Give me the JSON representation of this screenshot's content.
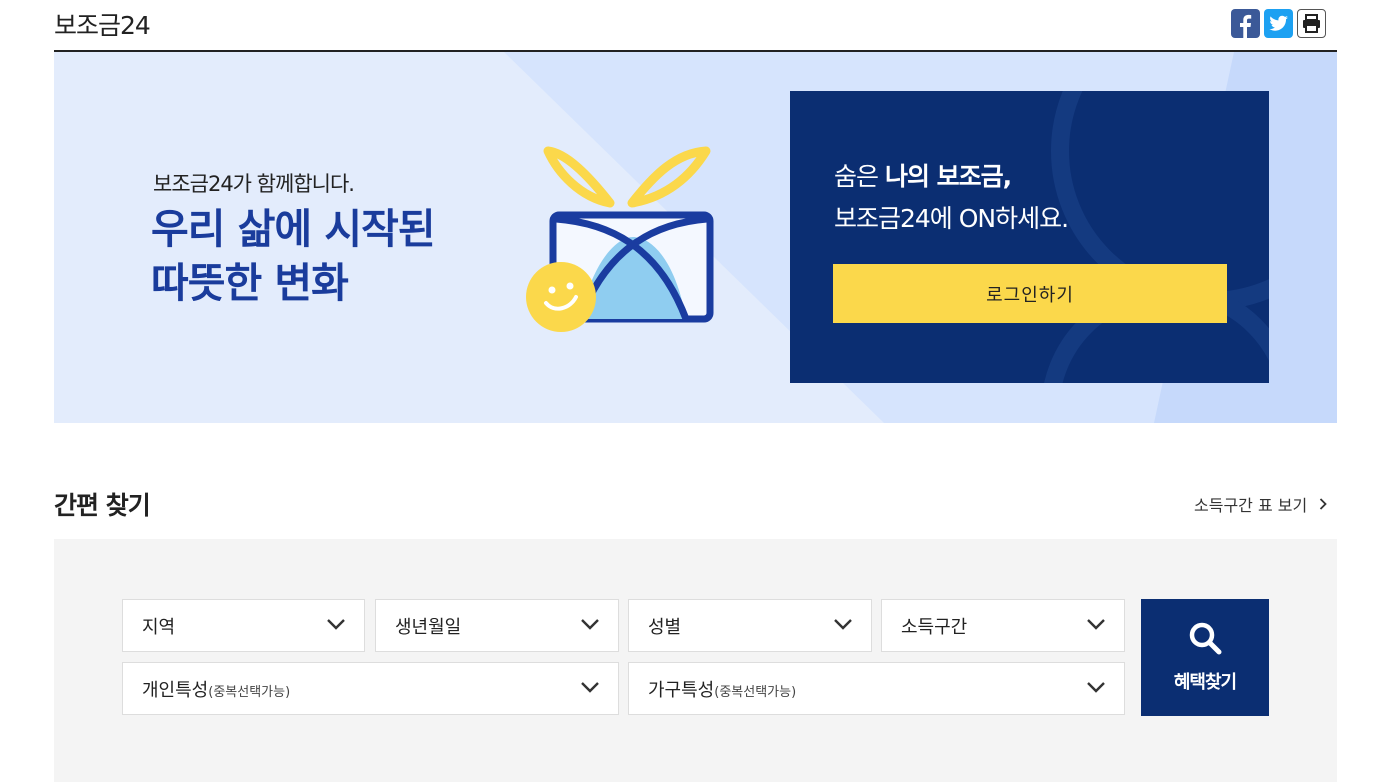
{
  "header": {
    "title": "보조금24"
  },
  "share": {
    "facebook_icon": "facebook-icon",
    "twitter_icon": "twitter-icon",
    "print_icon": "print-icon"
  },
  "banner": {
    "subtitle": "보조금24가 함께합니다.",
    "headline_line1": "우리 삶에 시작된",
    "headline_line2": "따뜻한 변화"
  },
  "login": {
    "message_prefix": "숨은 ",
    "message_bold": "나의 보조금,",
    "message_line2": "보조금24에 ON하세요.",
    "button_label": "로그인하기"
  },
  "quick_search": {
    "title": "간편 찾기",
    "income_table_link": "소득구간 표 보기",
    "selects": {
      "region": "지역",
      "birth": "생년월일",
      "gender": "성별",
      "income": "소득구간",
      "personal": "개인특성",
      "personal_note": "(중복선택가능)",
      "household": "가구특성",
      "household_note": "(중복선택가능)"
    },
    "search_button": "혜택찾기"
  },
  "colors": {
    "navy": "#0b2e72",
    "accent_yellow": "#fbd84b",
    "headline_blue": "#1a3c9c",
    "banner_bg": "#e3ecfc"
  }
}
